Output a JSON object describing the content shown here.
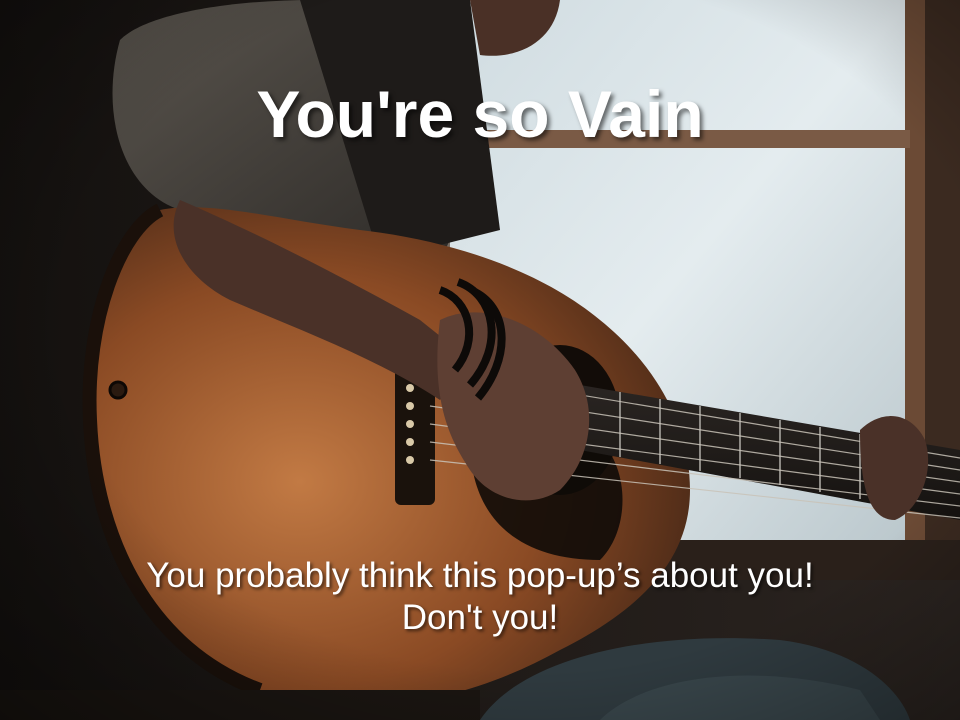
{
  "slide": {
    "title": "You're so Vain",
    "caption_line1": "You probably think this pop-up’s about you!",
    "caption_line2": "Don't you!"
  },
  "background": {
    "subject": "person playing acoustic guitar by a window",
    "colors": {
      "window_light": "#dfe8ec",
      "guitar_body": "#a0592b",
      "guitar_edge": "#2a1a10",
      "sweater": "#3d3a36",
      "skin": "#5a3d30",
      "wall_dark": "#1a1613"
    }
  }
}
